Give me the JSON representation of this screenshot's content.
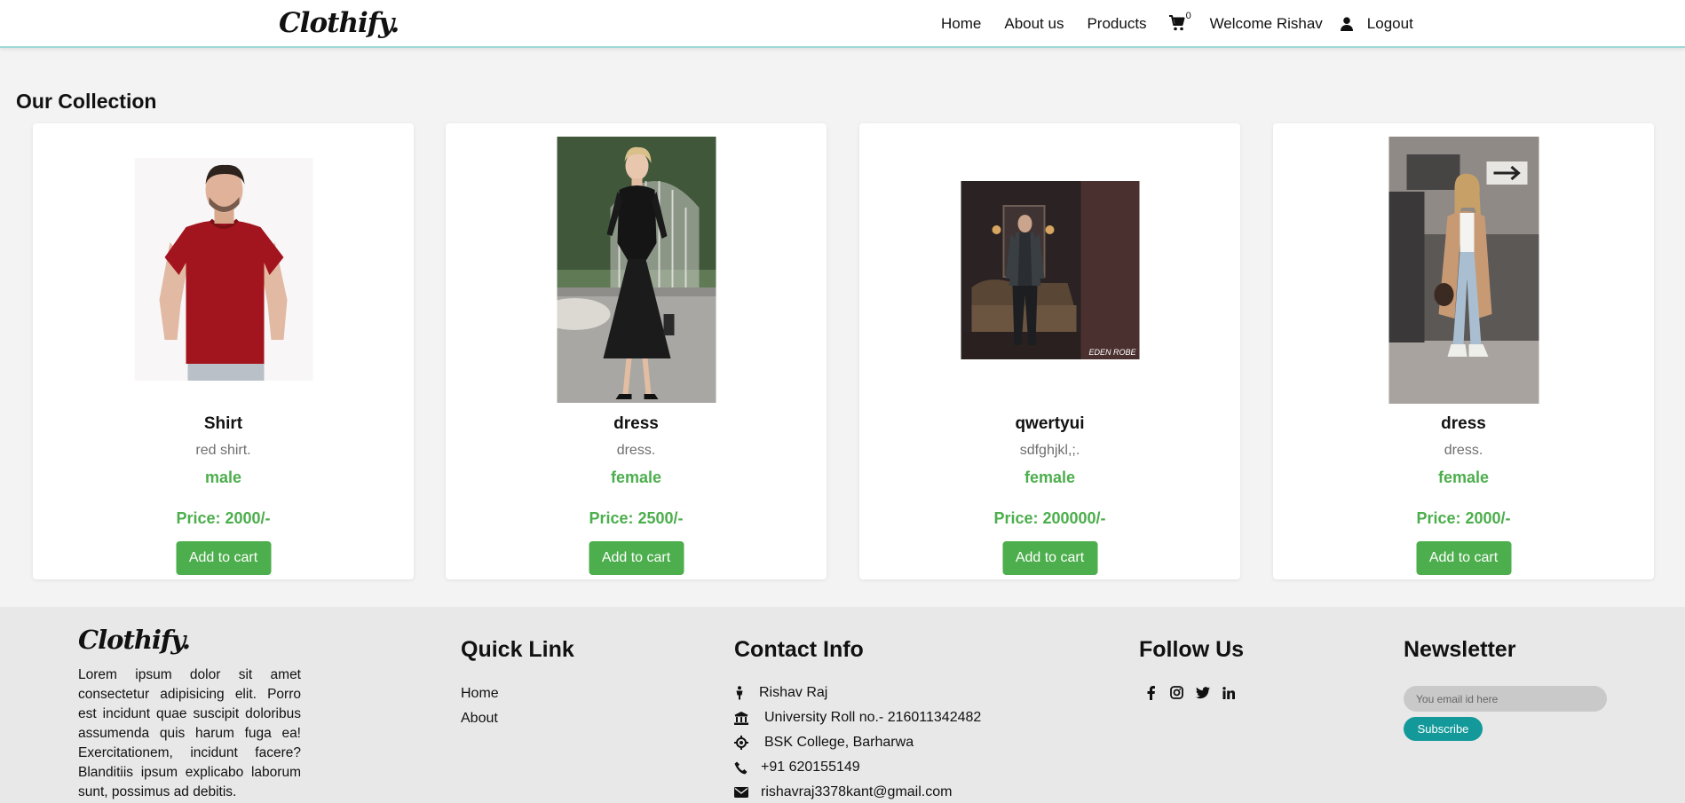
{
  "brand": {
    "name": "Clothify."
  },
  "nav": {
    "home": "Home",
    "about": "About us",
    "products": "Products",
    "cart_count": "0",
    "welcome": "Welcome Rishav",
    "logout": "Logout"
  },
  "main": {
    "title": "Our Collection",
    "products": [
      {
        "name": "Shirt",
        "description": "red shirt.",
        "gender": "male",
        "price": "Price: 2000/-",
        "button": "Add to cart"
      },
      {
        "name": "dress",
        "description": "dress.",
        "gender": "female",
        "price": "Price: 2500/-",
        "button": "Add to cart"
      },
      {
        "name": "qwertyui",
        "description": "sdfghjkl,;.",
        "gender": "female",
        "price": "Price: 200000/-",
        "button": "Add to cart",
        "image_caption": "EDEN ROBE"
      },
      {
        "name": "dress",
        "description": "dress.",
        "gender": "female",
        "price": "Price: 2000/-",
        "button": "Add to cart"
      }
    ]
  },
  "footer": {
    "brand": "Clothify.",
    "about_text": "Lorem ipsum dolor sit amet consectetur adipisicing elit. Porro est incidunt quae suscipit doloribus assumenda quis harum fuga ea! Exercitationem, incidunt facere? Blanditiis ipsum explicabo laborum sunt, possimus ad debitis.",
    "quick_link": {
      "heading": "Quick Link",
      "links": [
        "Home",
        "About"
      ]
    },
    "contact": {
      "heading": "Contact Info",
      "items": [
        {
          "icon": "person-icon",
          "text": "Rishav Raj"
        },
        {
          "icon": "institution-icon",
          "text": "University Roll no.- 216011342482"
        },
        {
          "icon": "location-icon",
          "text": "BSK College, Barharwa"
        },
        {
          "icon": "phone-icon",
          "text": "+91 620155149"
        },
        {
          "icon": "envelope-icon",
          "text": "rishavraj3378kant@gmail.com"
        }
      ]
    },
    "follow": {
      "heading": "Follow Us",
      "icons": [
        "facebook-icon",
        "instagram-icon",
        "twitter-icon",
        "linkedin-icon"
      ]
    },
    "newsletter": {
      "heading": "Newsletter",
      "placeholder": "You email id here",
      "button": "Subscribe"
    }
  },
  "colors": {
    "accent_green": "#4cae4c",
    "teal": "#14999a",
    "nav_border": "#9fd8d6"
  }
}
